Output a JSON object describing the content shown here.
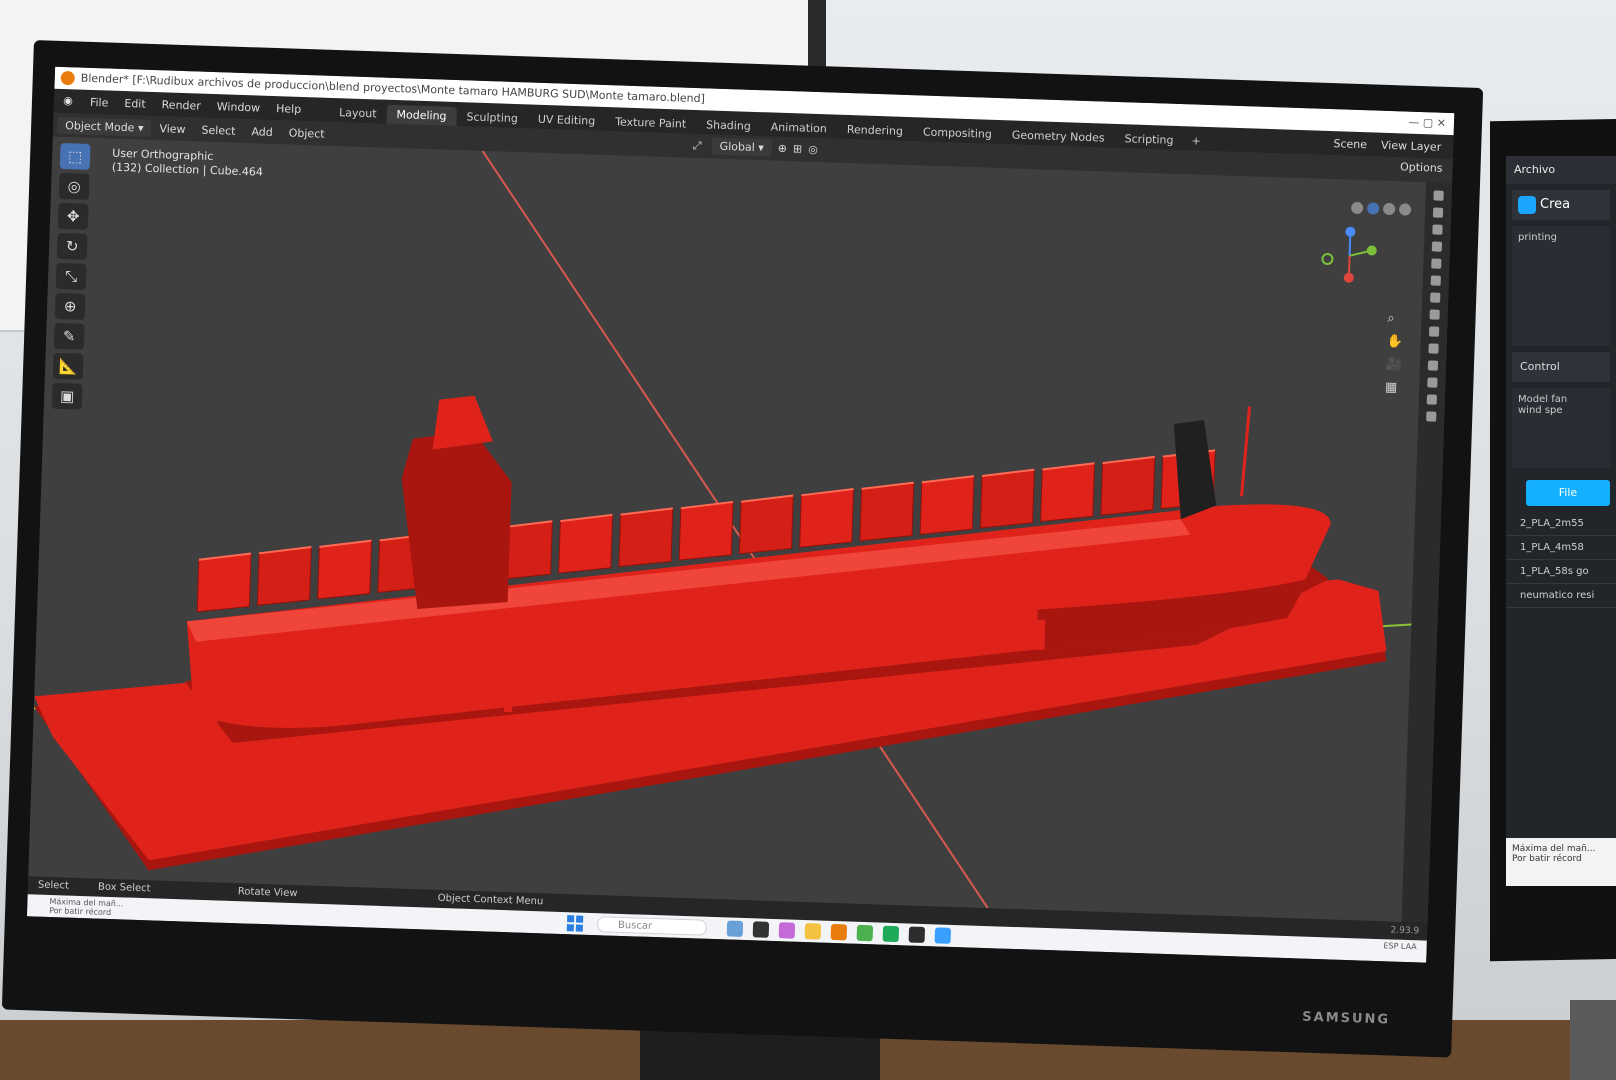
{
  "window": {
    "title": "Blender* [F:\\Rudibux archivos de produccion\\blend proyectos\\Monte tamaro HAMBURG SUD\\Monte tamaro.blend]"
  },
  "menus": [
    "File",
    "Edit",
    "Render",
    "Window",
    "Help"
  ],
  "workspace_tabs": [
    {
      "label": "Layout",
      "active": false
    },
    {
      "label": "Modeling",
      "active": true
    },
    {
      "label": "Sculpting",
      "active": false
    },
    {
      "label": "UV Editing",
      "active": false
    },
    {
      "label": "Texture Paint",
      "active": false
    },
    {
      "label": "Shading",
      "active": false
    },
    {
      "label": "Animation",
      "active": false
    },
    {
      "label": "Rendering",
      "active": false
    },
    {
      "label": "Compositing",
      "active": false
    },
    {
      "label": "Geometry Nodes",
      "active": false
    },
    {
      "label": "Scripting",
      "active": false
    }
  ],
  "scene_label": "Scene",
  "view_layer_label": "View Layer",
  "header": {
    "mode": "Object Mode",
    "view": "View",
    "select": "Select",
    "add": "Add",
    "object": "Object",
    "transform_orientation": "Global",
    "options": "Options"
  },
  "viewport": {
    "view_name": "User Orthographic",
    "collection_info": "(132) Collection | Cube.464",
    "model_color": "#e0231a",
    "grid_axis_x_color": "#d8584f",
    "grid_axis_y_color": "#8fc23a"
  },
  "status": {
    "select": "Select",
    "box_select": "Box Select",
    "rotate_view": "Rotate View",
    "context_menu": "Object Context Menu",
    "version": "2.93.9"
  },
  "taskbar": {
    "search_placeholder": "Buscar",
    "notification_title": "Máxima del mañ...",
    "notification_sub": "Por batir récord",
    "tray_lang": "ESP\nLAA"
  },
  "second_monitor": {
    "menu": "Archivo",
    "brand": "Crea",
    "panel": "printing",
    "control": "Control",
    "file_button": "File",
    "model_label": "Model fan",
    "wind_label": "wind spe",
    "files": [
      "2_PLA_2m55",
      "1_PLA_4m58",
      "1_PLA_58s go",
      "neumatico resi"
    ],
    "notice_title": "Máxima del mañ...",
    "notice_sub": "Por batir récord"
  },
  "monitor_brand": "SAMSUNG"
}
